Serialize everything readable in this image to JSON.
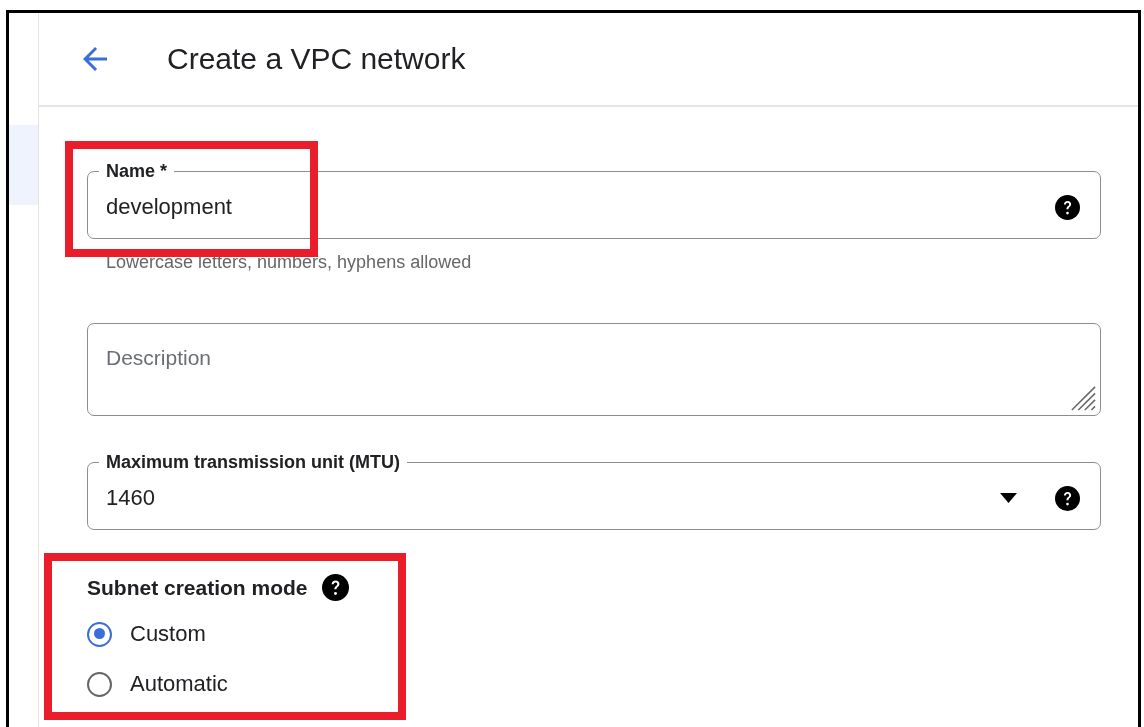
{
  "header": {
    "title": "Create a VPC network"
  },
  "fields": [
    {
      "kind": "text",
      "label": "Name *",
      "value": "development",
      "help": true,
      "highlighted": true,
      "helper": "Lowercase letters, numbers, hyphens allowed"
    },
    {
      "kind": "textarea",
      "placeholder": "Description",
      "help": false,
      "highlighted": false
    },
    {
      "kind": "select",
      "label": "Maximum transmission unit (MTU)",
      "value": "1460",
      "help": true,
      "highlighted": false
    }
  ],
  "subnet_mode": {
    "label": "Subnet creation mode",
    "help": true,
    "highlighted": true,
    "options": [
      {
        "label": "Custom",
        "selected": true
      },
      {
        "label": "Automatic",
        "selected": false
      }
    ]
  }
}
